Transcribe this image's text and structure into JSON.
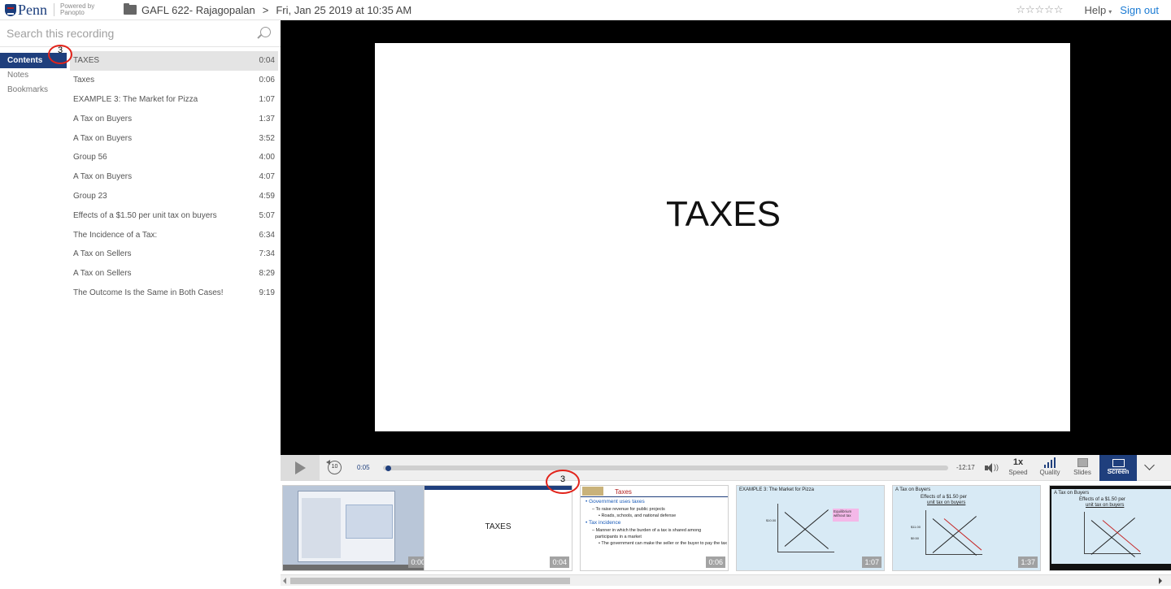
{
  "header": {
    "logo_text": "Penn",
    "powered_by": "Powered by",
    "powered_brand": "Panopto",
    "folder": "GAFL 622- Rajagopalan",
    "separator": ">",
    "session": "Fri, Jan 25 2019 at 10:35 AM",
    "rating": "☆☆☆☆☆",
    "help": "Help",
    "help_caret": "▾",
    "signout": "Sign out"
  },
  "search": {
    "placeholder": "Search this recording"
  },
  "nav": {
    "items": [
      {
        "label": "Contents"
      },
      {
        "label": "Notes"
      },
      {
        "label": "Bookmarks"
      }
    ]
  },
  "toc": [
    {
      "title": "TAXES",
      "time": "0:04"
    },
    {
      "title": "Taxes",
      "time": "0:06"
    },
    {
      "title": "EXAMPLE 3: The Market for Pizza",
      "time": "1:07"
    },
    {
      "title": "A Tax on Buyers",
      "time": "1:37"
    },
    {
      "title": "A Tax on Buyers",
      "time": "3:52"
    },
    {
      "title": "Group 56",
      "time": "4:00"
    },
    {
      "title": "A Tax on Buyers",
      "time": "4:07"
    },
    {
      "title": "Group 23",
      "time": "4:59"
    },
    {
      "title": "Effects of a $1.50 per unit tax on buyers",
      "time": "5:07"
    },
    {
      "title": "The Incidence of a Tax:",
      "time": "6:34"
    },
    {
      "title": "A Tax on Sellers",
      "time": "7:34"
    },
    {
      "title": "A Tax on Sellers",
      "time": "8:29"
    },
    {
      "title": "The Outcome Is the Same in Both Cases!",
      "time": "9:19"
    }
  ],
  "slide": {
    "title": "TAXES"
  },
  "controls": {
    "rewind_label": "10",
    "elapsed": "0:05",
    "remaining": "-12:17",
    "progress": 0.007,
    "volume_wave": "))",
    "speed_value": "1x",
    "speed_label": "Speed",
    "quality_label": "Quality",
    "slides_label": "Slides",
    "screen_label": "Screen"
  },
  "thumbnails": [
    {
      "time": "0:00"
    },
    {
      "time": "0:04",
      "text": "TAXES"
    },
    {
      "time": "0:06",
      "title": "Taxes",
      "b1": "• Government uses taxes",
      "b2": "– To raise revenue for public projects",
      "b3": "• Roads, schools, and national defense",
      "b4": "• Tax incidence",
      "b5": "– Manner in which the burden of a tax is shared among",
      "b6": "participants in a market",
      "b7": "• The government can make the seller or the buyer to pay the tax"
    },
    {
      "time": "1:07",
      "title": "EXAMPLE 3: The Market for Pizza",
      "note": "Equilibrium without tax",
      "price": "$10.00"
    },
    {
      "time": "1:37",
      "title": "A Tax on Buyers",
      "sub1": "Effects of a $1.50 per",
      "sub2": "unit tax on buyers",
      "p1": "$11.00",
      "p2": "$9.50"
    },
    {
      "title": "A Tax on Buyers",
      "sub1": "Effects of a $1.50 per",
      "sub2": "unit tax on buyers"
    }
  ],
  "annotations": {
    "marker1": "3",
    "marker2": "3"
  },
  "colors": {
    "accent": "#1f3f7d",
    "link": "#1a7ad3",
    "marker": "#e2231a"
  }
}
